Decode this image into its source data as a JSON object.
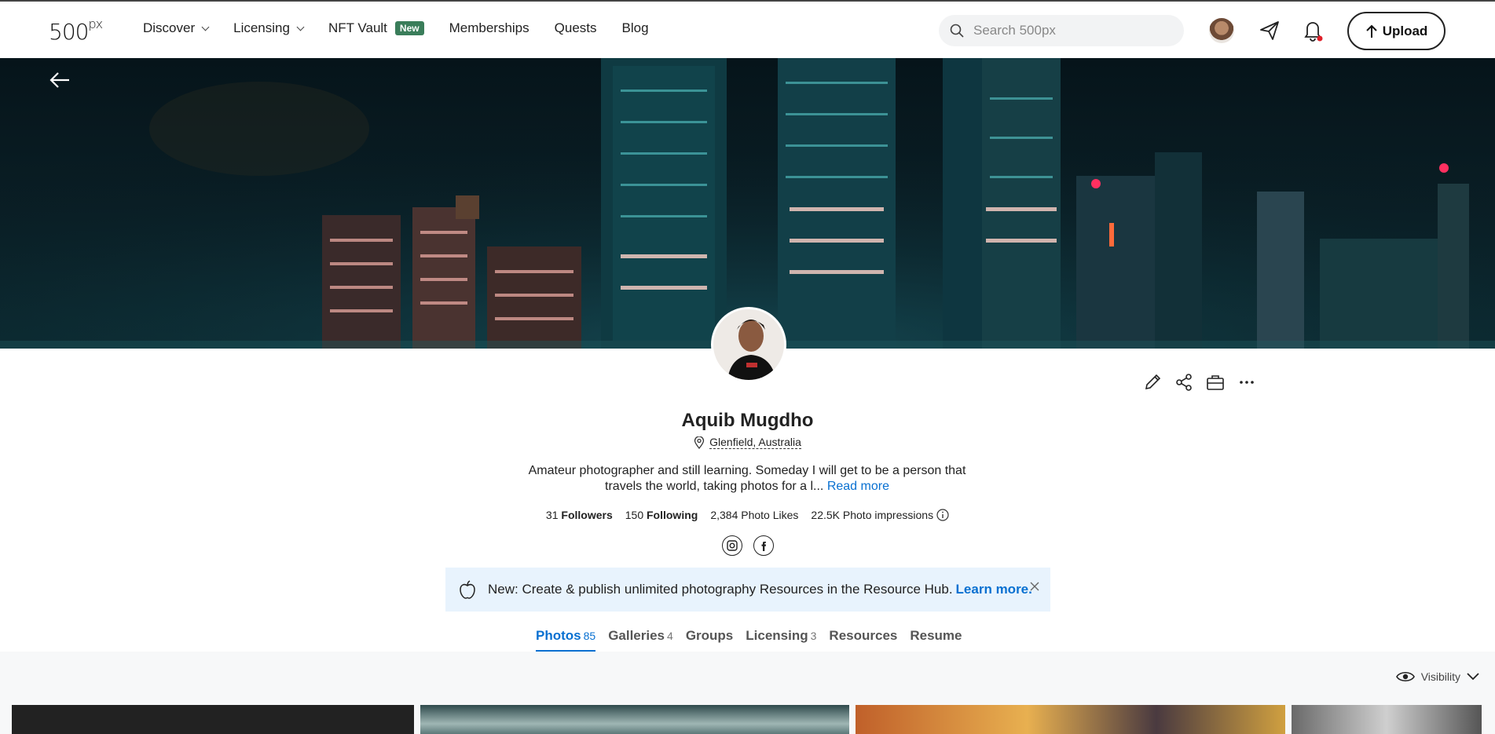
{
  "nav": {
    "logo": "500",
    "logo_suffix": "px",
    "items": [
      {
        "label": "Discover",
        "has_dropdown": true
      },
      {
        "label": "Licensing",
        "has_dropdown": true
      },
      {
        "label": "NFT Vault",
        "badge": "New"
      },
      {
        "label": "Memberships"
      },
      {
        "label": "Quests"
      },
      {
        "label": "Blog"
      }
    ],
    "search_placeholder": "Search 500px",
    "upload_label": "Upload"
  },
  "profile": {
    "name": "Aquib Mugdho",
    "location": "Glenfield, Australia",
    "bio": "Amateur photographer and still learning. Someday I will get to be a person that travels the world, taking photos for a l...",
    "read_more": "Read more",
    "stats": {
      "followers_count": "31",
      "followers_label": "Followers",
      "following_count": "150",
      "following_label": "Following",
      "likes": "2,384 Photo Likes",
      "impressions": "22.5K Photo impressions"
    }
  },
  "banner": {
    "prefix": "New: Create & publish unlimited photography Resources in the Resource Hub.",
    "link": "Learn more."
  },
  "tabs": [
    {
      "label": "Photos",
      "count": "85",
      "active": true
    },
    {
      "label": "Galleries",
      "count": "4"
    },
    {
      "label": "Groups",
      "count": ""
    },
    {
      "label": "Licensing",
      "count": "3"
    },
    {
      "label": "Resources",
      "count": ""
    },
    {
      "label": "Resume",
      "count": ""
    }
  ],
  "gallery": {
    "visibility_label": "Visibility"
  }
}
